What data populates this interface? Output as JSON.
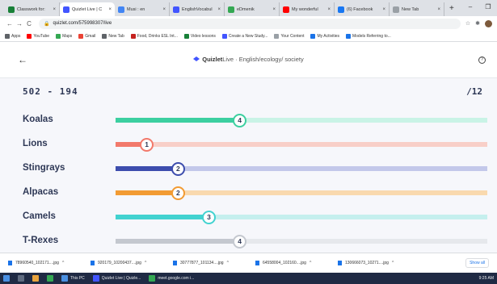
{
  "browser": {
    "tabs": [
      {
        "title": "Classwork for:",
        "icon": "classroom-icon",
        "color": "#188038",
        "active": false
      },
      {
        "title": "Quizlet Live | C",
        "icon": "quizlet-icon",
        "color": "#4255ff",
        "active": true
      },
      {
        "title": "Musi : en",
        "icon": "music-icon",
        "color": "#4285f4",
        "active": false
      },
      {
        "title": "EnglishVocabul",
        "icon": "quizlet-icon",
        "color": "#4255ff",
        "active": false
      },
      {
        "title": "eDmenik",
        "icon": "edmenik-icon",
        "color": "#34a853",
        "active": false
      },
      {
        "title": "My wonderful",
        "icon": "youtube-icon",
        "color": "#ff0000",
        "active": false
      },
      {
        "title": "(6) Facebook",
        "icon": "facebook-icon",
        "color": "#1877f2",
        "active": false
      },
      {
        "title": "New Tab",
        "icon": "newtab-icon",
        "color": "#9aa0a6",
        "active": false
      }
    ],
    "url": "quizlet.com/575998307/live",
    "bookmarks": [
      {
        "label": "Apps",
        "color": "#5f6368"
      },
      {
        "label": "YouTube",
        "color": "#ff0000"
      },
      {
        "label": "Maps",
        "color": "#34a853"
      },
      {
        "label": "Gmail",
        "color": "#ea4335"
      },
      {
        "label": "New Tab",
        "color": "#5f6368"
      },
      {
        "label": "Food, Drinks ESL Int...",
        "color": "#c5221f"
      },
      {
        "label": "Video lessons",
        "color": "#188038"
      },
      {
        "label": "Create a New Study...",
        "color": "#4255ff"
      },
      {
        "label": "Your Content",
        "color": "#9aa0a6"
      },
      {
        "label": "My Activities",
        "color": "#1a73e8"
      },
      {
        "label": "Models Referring to...",
        "color": "#1a73e8"
      }
    ]
  },
  "header": {
    "brand": "Quizlet",
    "subtitle": "Live · English/ecology/ society"
  },
  "game": {
    "score": "502 - 194",
    "total": "/12",
    "teams": [
      {
        "name": "Koalas",
        "score": "4",
        "fraction": 0.333,
        "color": "#3ccfa0",
        "track": "#c9f3e6"
      },
      {
        "name": "Lions",
        "score": "1",
        "fraction": 0.083,
        "color": "#f2796b",
        "track": "#f8cfc8"
      },
      {
        "name": "Stingrays",
        "score": "2",
        "fraction": 0.167,
        "color": "#3d4dad",
        "track": "#c3c8ea"
      },
      {
        "name": "Alpacas",
        "score": "2",
        "fraction": 0.167,
        "color": "#f29b33",
        "track": "#f9d9ae"
      },
      {
        "name": "Camels",
        "score": "3",
        "fraction": 0.25,
        "color": "#42d2d0",
        "track": "#c5efee"
      },
      {
        "name": "T-Rexes",
        "score": "4",
        "fraction": 0.333,
        "color": "#c4c8cf",
        "track": "#e6e8ec"
      }
    ]
  },
  "downloads": {
    "items": [
      "78960540_102171....jpg",
      "920179_10200437....jpg",
      "30777877_101134....jpg",
      "64558004_102160....jpg",
      "130666073_10271....jpg"
    ],
    "show_all": "Show all"
  },
  "taskbar": {
    "items": [
      "This PC",
      "Quizlet Live | Quizle...",
      "meet.google.com i..."
    ],
    "time": "9:25 AM"
  }
}
